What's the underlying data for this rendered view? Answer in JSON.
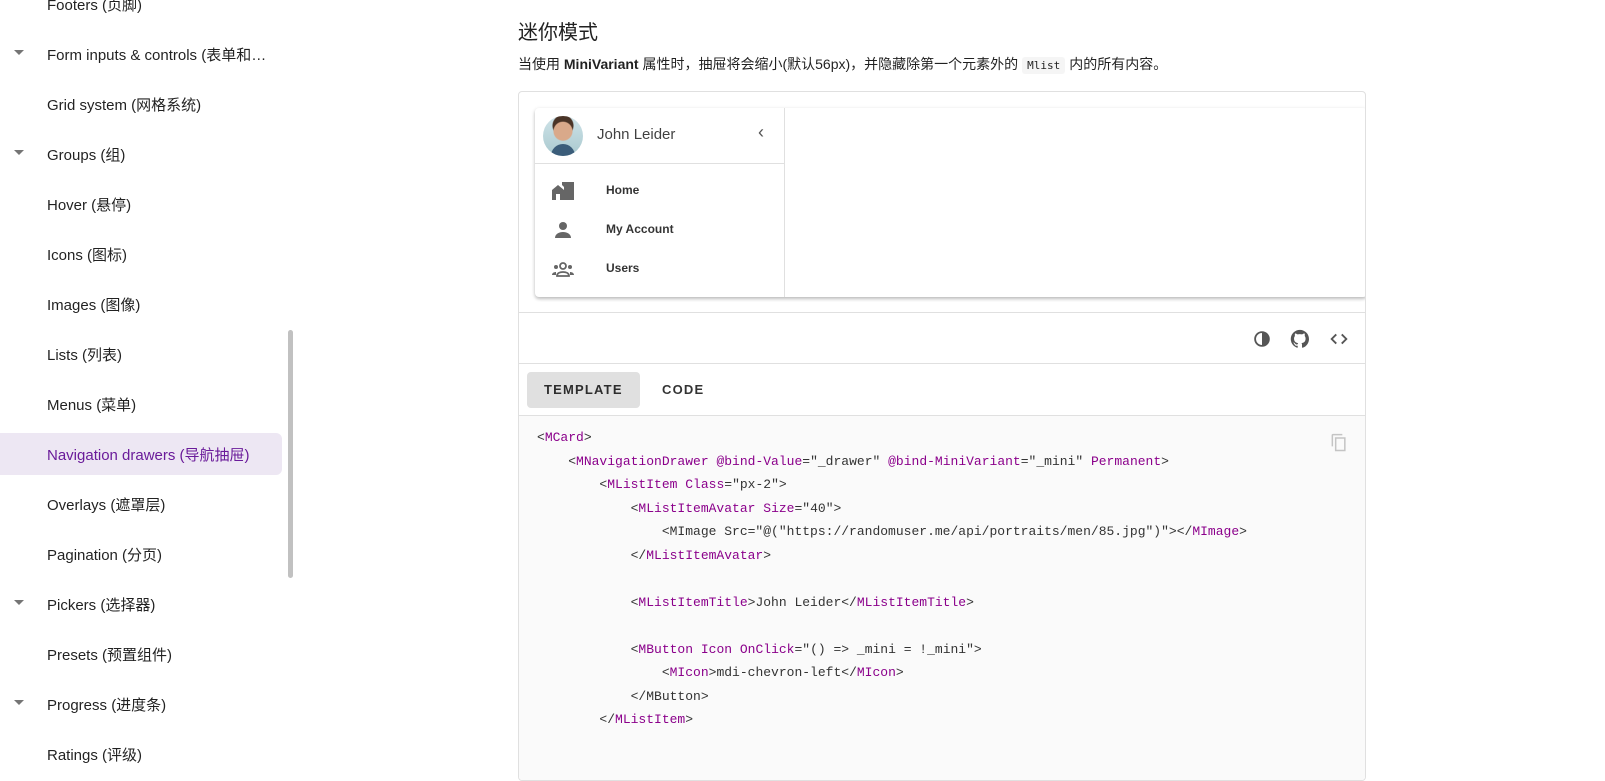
{
  "sidebar": {
    "items": [
      {
        "label": "Footers (页脚)",
        "caret": false
      },
      {
        "label": "Form inputs & controls (表单和…",
        "caret": true
      },
      {
        "label": "Grid system (网格系统)",
        "caret": false
      },
      {
        "label": "Groups (组)",
        "caret": true
      },
      {
        "label": "Hover (悬停)",
        "caret": false
      },
      {
        "label": "Icons (图标)",
        "caret": false
      },
      {
        "label": "Images (图像)",
        "caret": false
      },
      {
        "label": "Lists (列表)",
        "caret": false
      },
      {
        "label": "Menus (菜单)",
        "caret": false
      },
      {
        "label": "Navigation drawers (导航抽屉)",
        "caret": false,
        "active": true
      },
      {
        "label": "Overlays (遮罩层)",
        "caret": false
      },
      {
        "label": "Pagination (分页)",
        "caret": false
      },
      {
        "label": "Pickers (选择器)",
        "caret": true
      },
      {
        "label": "Presets (预置组件)",
        "caret": false
      },
      {
        "label": "Progress (进度条)",
        "caret": true
      },
      {
        "label": "Ratings (评级)",
        "caret": false
      }
    ]
  },
  "section": {
    "title": "迷你模式",
    "desc_prefix": "当使用 ",
    "desc_bold": "MiniVariant",
    "desc_mid": " 属性时，抽屉将会缩小(默认56px)，并隐藏除第一个元素外的",
    "desc_code": "Mlist",
    "desc_suffix": "内的所有内容。"
  },
  "demo": {
    "user_name": "John Leider",
    "items": [
      {
        "label": "Home",
        "icon": "home-city-icon"
      },
      {
        "label": "My Account",
        "icon": "account-icon"
      },
      {
        "label": "Users",
        "icon": "account-group-icon"
      }
    ]
  },
  "tabs": [
    "TEMPLATE",
    "CODE"
  ],
  "code_lines": [
    [
      [
        "<",
        "p"
      ],
      [
        "MCard",
        "tag"
      ],
      [
        ">",
        "p"
      ]
    ],
    [
      [
        "    <",
        "p"
      ],
      [
        "MNavigationDrawer",
        "tag"
      ],
      [
        " ",
        "p"
      ],
      [
        "@bind-Value",
        "attr"
      ],
      [
        "=\"_drawer\" ",
        "p"
      ],
      [
        "@bind-MiniVariant",
        "attr"
      ],
      [
        "=\"_mini\" ",
        "p"
      ],
      [
        "Permanent",
        "attr"
      ],
      [
        ">",
        "p"
      ]
    ],
    [
      [
        "        <",
        "p"
      ],
      [
        "MListItem",
        "tag"
      ],
      [
        " ",
        "p"
      ],
      [
        "Class",
        "attr"
      ],
      [
        "=\"px-2\">",
        "p"
      ]
    ],
    [
      [
        "            <",
        "p"
      ],
      [
        "MListItemAvatar",
        "tag"
      ],
      [
        " ",
        "p"
      ],
      [
        "Size",
        "attr"
      ],
      [
        "=\"40\">",
        "p"
      ]
    ],
    [
      [
        "                <MImage Src=\"@(\"https://randomuser.me/api/portraits/men/85.jpg\")\"></",
        "p"
      ],
      [
        "MImage",
        "tag"
      ],
      [
        ">",
        "p"
      ]
    ],
    [
      [
        "            </",
        "p"
      ],
      [
        "MListItemAvatar",
        "tag"
      ],
      [
        ">",
        "p"
      ]
    ],
    [
      [
        "",
        "p"
      ]
    ],
    [
      [
        "            <",
        "p"
      ],
      [
        "MListItemTitle",
        "tag"
      ],
      [
        ">John Leider</",
        "p"
      ],
      [
        "MListItemTitle",
        "tag"
      ],
      [
        ">",
        "p"
      ]
    ],
    [
      [
        "",
        "p"
      ]
    ],
    [
      [
        "            <",
        "p"
      ],
      [
        "MButton",
        "tag"
      ],
      [
        " ",
        "p"
      ],
      [
        "Icon",
        "attr"
      ],
      [
        " ",
        "p"
      ],
      [
        "OnClick",
        "attr"
      ],
      [
        "=\"() => _mini = !_mini\">",
        "p"
      ]
    ],
    [
      [
        "                <",
        "p"
      ],
      [
        "MIcon",
        "tag"
      ],
      [
        ">mdi-chevron-left</",
        "p"
      ],
      [
        "MIcon",
        "tag"
      ],
      [
        ">",
        "p"
      ]
    ],
    [
      [
        "            </MButton>",
        "p"
      ]
    ],
    [
      [
        "        </",
        "p"
      ],
      [
        "MListItem",
        "tag"
      ],
      [
        ">",
        "p"
      ]
    ]
  ]
}
